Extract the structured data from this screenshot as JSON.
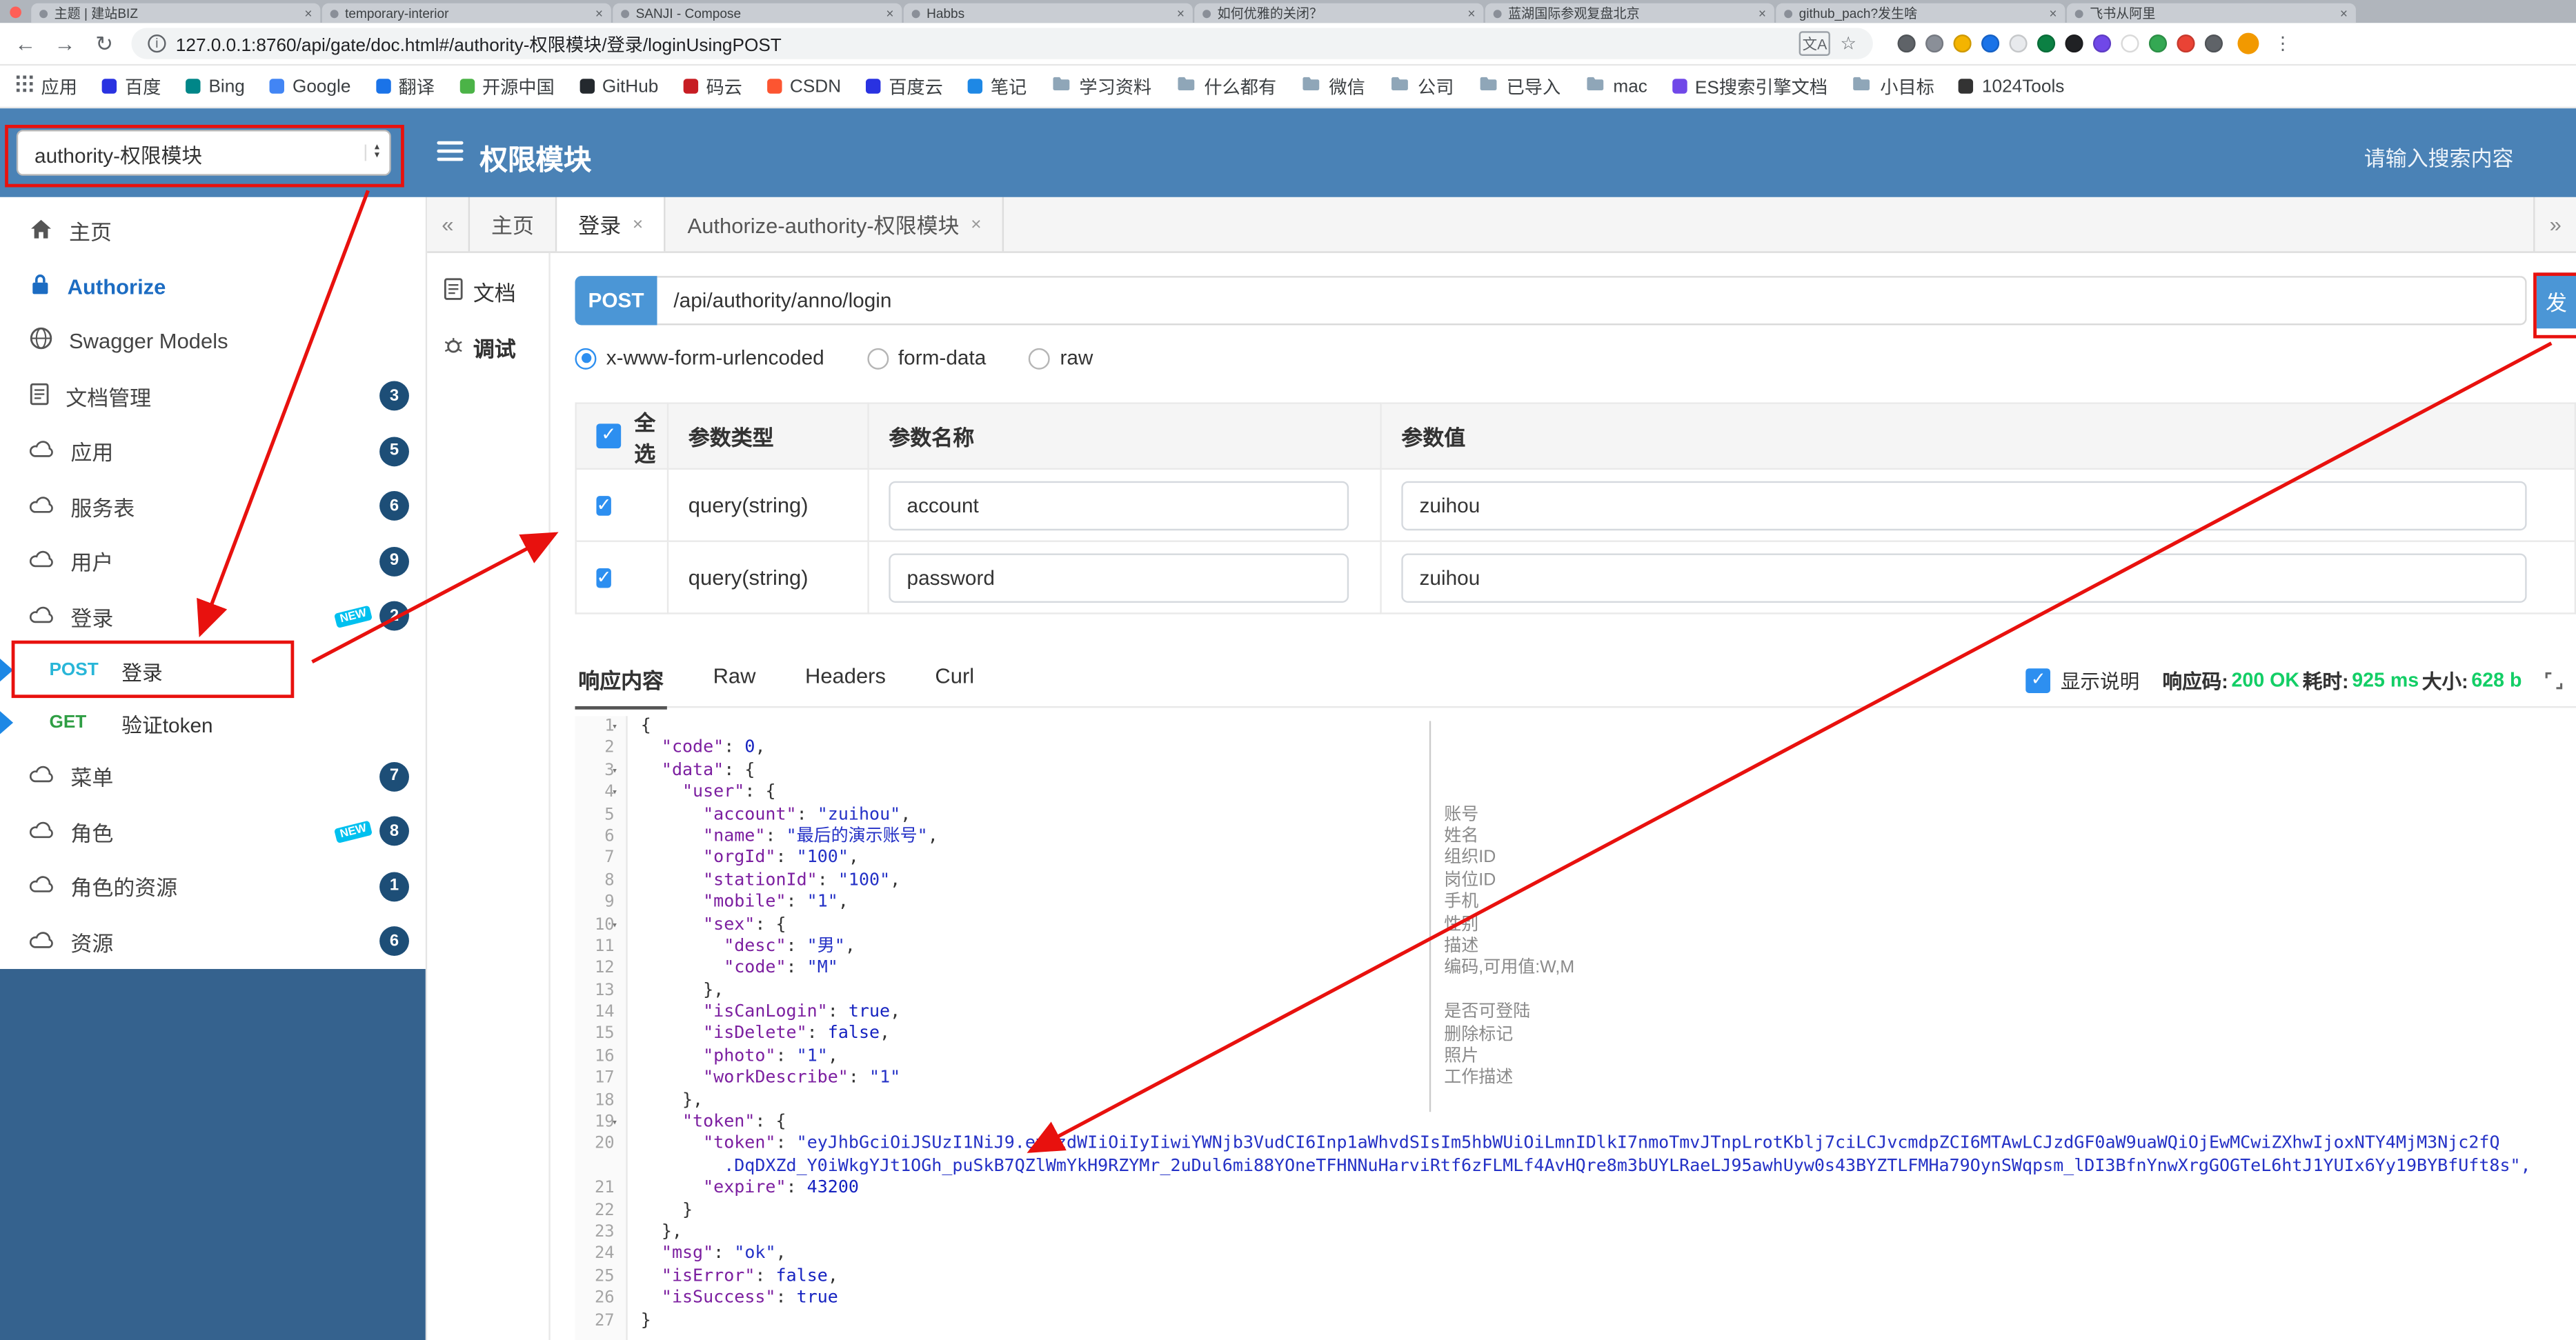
{
  "colors": {
    "header_blue": "#4a82b6",
    "sidebar_dark": "#35628e",
    "primary_blue": "#4b96d6",
    "badge_bg": "#1d4e77",
    "new_tag": "#00c0ef",
    "post_cyan": "#29b6d8",
    "get_green": "#2f9e44",
    "success_green": "#13ce66",
    "annotation_red": "#e8110e"
  },
  "browser": {
    "tabs": [
      "主题 | 建站BIZ",
      "temporary-interior",
      "SANJI - Compose",
      "Habbs",
      "如何优雅的关闭？",
      "蓝湖国际参观复盘北京",
      "github_pach?发生啥",
      "飞书从阿里"
    ],
    "url": "127.0.0.1:8760/api/gate/doc.html#/authority-权限模块/登录/loginUsingPOST",
    "extension_colors": [
      "#5f6368",
      "#8a8f98",
      "#f4b400",
      "#1a73e8",
      "#e8eaed",
      "#0b8043",
      "#202124",
      "#7048e8",
      "#ffffff",
      "#34a853",
      "#ea4335",
      "#5f6368"
    ],
    "bookmarks": [
      {
        "label": "应用",
        "icon": "apps-grid"
      },
      {
        "label": "百度",
        "icon": "site",
        "color": "#2932e1"
      },
      {
        "label": "Bing",
        "icon": "site",
        "color": "#008688"
      },
      {
        "label": "Google",
        "icon": "site",
        "color": "#4285f4"
      },
      {
        "label": "翻译",
        "icon": "site",
        "color": "#1a73e8"
      },
      {
        "label": "开源中国",
        "icon": "site",
        "color": "#4bb347"
      },
      {
        "label": "GitHub",
        "icon": "site",
        "color": "#24292e"
      },
      {
        "label": "码云",
        "icon": "site",
        "color": "#c71d23"
      },
      {
        "label": "CSDN",
        "icon": "site",
        "color": "#fc5531"
      },
      {
        "label": "百度云",
        "icon": "site",
        "color": "#2932e1"
      },
      {
        "label": "笔记",
        "icon": "site",
        "color": "#1e88e5"
      },
      {
        "label": "学习资料",
        "icon": "folder"
      },
      {
        "label": "什么都有",
        "icon": "folder"
      },
      {
        "label": "微信",
        "icon": "folder"
      },
      {
        "label": "公司",
        "icon": "folder"
      },
      {
        "label": "已导入",
        "icon": "folder"
      },
      {
        "label": "mac",
        "icon": "folder"
      },
      {
        "label": "ES搜索引擎文档",
        "icon": "site",
        "color": "#7048e8"
      },
      {
        "label": "小目标",
        "icon": "folder"
      },
      {
        "label": "1024Tools",
        "icon": "site",
        "color": "#333333"
      }
    ]
  },
  "header": {
    "group_select_value": "authority-权限模块",
    "title": "权限模块",
    "search_placeholder": "请输入搜索内容"
  },
  "sidebar": {
    "items": [
      {
        "key": "home",
        "label": "主页",
        "icon": "home"
      },
      {
        "key": "authorize",
        "label": "Authorize",
        "icon": "lock",
        "style": "link"
      },
      {
        "key": "swagger-models",
        "label": "Swagger Models",
        "icon": "globe"
      },
      {
        "key": "doc-manage",
        "label": "文档管理",
        "icon": "doc",
        "badge": "3"
      },
      {
        "key": "app",
        "label": "应用",
        "icon": "cloud",
        "badge": "5"
      },
      {
        "key": "service",
        "label": "服务表",
        "icon": "cloud",
        "badge": "6"
      },
      {
        "key": "user",
        "label": "用户",
        "icon": "cloud",
        "badge": "9"
      },
      {
        "key": "login",
        "label": "登录",
        "icon": "cloud",
        "badge": "2",
        "new": true,
        "children": [
          {
            "method": "POST",
            "label": "登录",
            "highlighted": true
          },
          {
            "method": "GET",
            "label": "验证token"
          }
        ]
      },
      {
        "key": "menu",
        "label": "菜单",
        "icon": "cloud",
        "badge": "7"
      },
      {
        "key": "role",
        "label": "角色",
        "icon": "cloud",
        "badge": "8",
        "new": true
      },
      {
        "key": "role-resource",
        "label": "角色的资源",
        "icon": "cloud",
        "badge": "1"
      },
      {
        "key": "resource",
        "label": "资源",
        "icon": "cloud",
        "badge": "6"
      }
    ]
  },
  "doc_tabs": {
    "left_chevron": "«",
    "right_chevron": "»",
    "tabs": [
      {
        "label": "主页",
        "closable": false,
        "active": false
      },
      {
        "label": "登录",
        "closable": true,
        "active": true
      },
      {
        "label": "Authorize-authority-权限模块",
        "closable": true,
        "active": false
      }
    ]
  },
  "mode_nav": {
    "items": [
      {
        "label": "文档",
        "icon": "doc",
        "active": false
      },
      {
        "label": "调试",
        "icon": "debug",
        "active": true
      }
    ]
  },
  "request": {
    "method": "POST",
    "url": "/api/authority/anno/login",
    "send_label": "发",
    "content_types": [
      {
        "label": "x-www-form-urlencoded",
        "selected": true
      },
      {
        "label": "form-data",
        "selected": false
      },
      {
        "label": "raw",
        "selected": false
      }
    ]
  },
  "params_table": {
    "headers": [
      "全选",
      "参数类型",
      "参数名称",
      "参数值"
    ],
    "rows": [
      {
        "checked": true,
        "type": "query(string)",
        "name": "account",
        "value": "zuihou"
      },
      {
        "checked": true,
        "type": "query(string)",
        "name": "password",
        "value": "zuihou"
      }
    ]
  },
  "response": {
    "tabs": [
      {
        "label": "响应内容",
        "active": true
      },
      {
        "label": "Raw",
        "active": false
      },
      {
        "label": "Headers",
        "active": false
      },
      {
        "label": "Curl",
        "active": false
      }
    ],
    "show_desc_label": "显示说明",
    "show_desc_checked": true,
    "meta": [
      {
        "label": "响应码:",
        "value": "200 OK"
      },
      {
        "label": "耗时:",
        "value": "925 ms"
      },
      {
        "label": "大小:",
        "value": "628 b"
      }
    ]
  },
  "code": {
    "lines": [
      {
        "n": 1,
        "fold": true,
        "text": "{"
      },
      {
        "n": 2,
        "text": "  \"code\": 0,"
      },
      {
        "n": 3,
        "fold": true,
        "text": "  \"data\": {"
      },
      {
        "n": 4,
        "fold": true,
        "text": "    \"user\": {"
      },
      {
        "n": 5,
        "text": "      \"account\": \"zuihou\","
      },
      {
        "n": 6,
        "text": "      \"name\": \"最后的演示账号\","
      },
      {
        "n": 7,
        "text": "      \"orgId\": \"100\","
      },
      {
        "n": 8,
        "text": "      \"stationId\": \"100\","
      },
      {
        "n": 9,
        "text": "      \"mobile\": \"1\","
      },
      {
        "n": 10,
        "fold": true,
        "text": "      \"sex\": {"
      },
      {
        "n": 11,
        "text": "        \"desc\": \"男\","
      },
      {
        "n": 12,
        "text": "        \"code\": \"M\""
      },
      {
        "n": 13,
        "text": "      },"
      },
      {
        "n": 14,
        "text": "      \"isCanLogin\": true,"
      },
      {
        "n": 15,
        "text": "      \"isDelete\": false,"
      },
      {
        "n": 16,
        "text": "      \"photo\": \"1\","
      },
      {
        "n": 17,
        "text": "      \"workDescribe\": \"1\""
      },
      {
        "n": 18,
        "text": "    },"
      },
      {
        "n": 19,
        "fold": true,
        "text": "    \"token\": {"
      },
      {
        "n": 20,
        "seg": [
          {
            "t": "      "
          },
          {
            "c": "jk",
            "t": "\"token\""
          },
          {
            "t": ": "
          },
          {
            "c": "js",
            "t": "\"eyJhbGciOiJSUzI1NiJ9.eyJzdWIiOiIyIiwiYWNjb3VudCI6Inp1aWhvdSIsIm5hbWUiOiLmnIDlkI7nmoTmvJTnpLrotKblj7ciLCJvcmdpZCI6MTAwLCJzdGF0aW9uaWQiOjEwMCwiZXhwIjoxNTY4MjM3Njc2fQ"
          }
        ]
      },
      {
        "n": null,
        "seg": [
          {
            "t": "        "
          },
          {
            "c": "js",
            "t": ".DqDXZd_Y0iWkgYJt1OGh_puSkB7QZlWmYkH9RZYMr_2uDul6mi88YOneTFHNNuHarviRtf6zFLMLf4AvHQre8m3bUYLRaeLJ95awhUyw0s43BYZTLFMHa79OynSWqpsm_lDI3BfnYnwXrgGOGTeL6htJ1YUIx6Yy19BYBfUft8s\","
          }
        ]
      },
      {
        "n": 21,
        "text": "      \"expire\": 43200"
      },
      {
        "n": 22,
        "text": "    }"
      },
      {
        "n": 23,
        "text": "  },"
      },
      {
        "n": 24,
        "text": "  \"msg\": \"ok\","
      },
      {
        "n": 25,
        "text": "  \"isError\": false,"
      },
      {
        "n": 26,
        "text": "  \"isSuccess\": true"
      },
      {
        "n": 27,
        "text": "}"
      }
    ],
    "annotations": [
      {
        "line": 5,
        "text": "账号"
      },
      {
        "line": 6,
        "text": "姓名"
      },
      {
        "line": 7,
        "text": "组织ID"
      },
      {
        "line": 8,
        "text": "岗位ID"
      },
      {
        "line": 9,
        "text": "手机"
      },
      {
        "line": 10,
        "text": "性别"
      },
      {
        "line": 11,
        "text": "描述"
      },
      {
        "line": 12,
        "text": "编码,可用值:W,M"
      },
      {
        "line": 14,
        "text": "是否可登陆"
      },
      {
        "line": 15,
        "text": "删除标记"
      },
      {
        "line": 16,
        "text": "照片"
      },
      {
        "line": 17,
        "text": "工作描述"
      }
    ]
  }
}
